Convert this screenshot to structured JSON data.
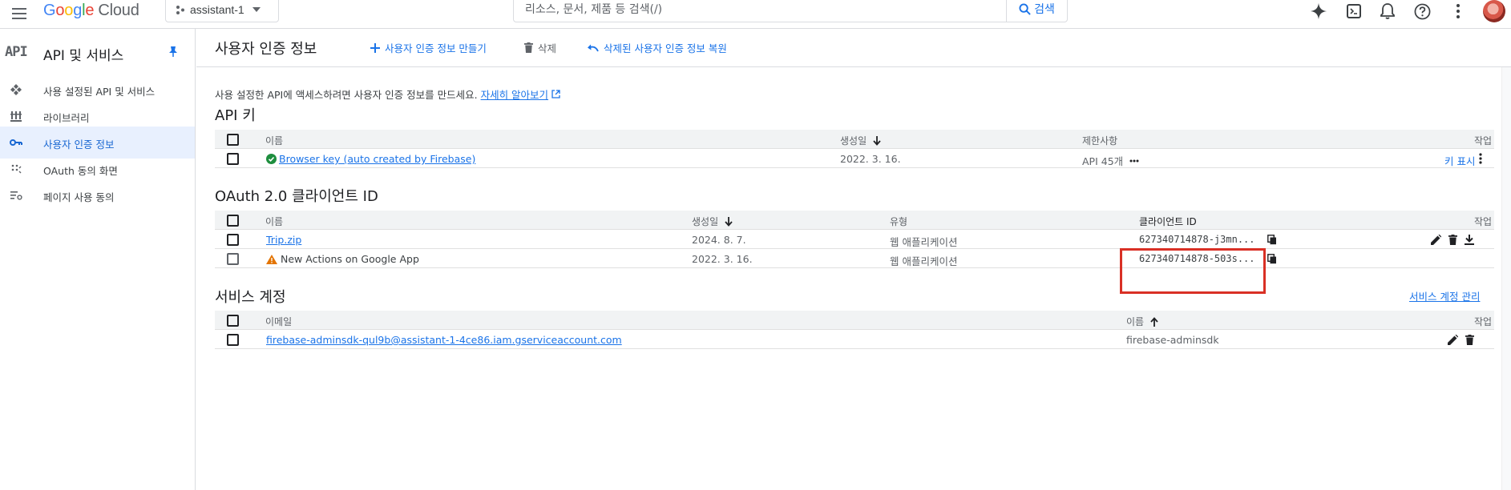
{
  "topbar": {
    "logo_google": "Google",
    "logo_cloud": "Cloud",
    "project": "assistant-1",
    "search_placeholder": "리소스, 문서, 제품 등 검색(/)",
    "search_button": "검색"
  },
  "leftnav": {
    "api_mark": "API",
    "title": "API 및 서비스",
    "items": [
      {
        "label": "사용 설정된 API 및 서비스",
        "icon": "api-hub-icon"
      },
      {
        "label": "라이브러리",
        "icon": "library-icon"
      },
      {
        "label": "사용자 인증 정보",
        "icon": "key-icon",
        "active": true
      },
      {
        "label": "OAuth 동의 화면",
        "icon": "oauth-icon"
      },
      {
        "label": "페이지 사용 동의",
        "icon": "page-consent-icon"
      }
    ]
  },
  "main": {
    "title": "사용자 인증 정보",
    "actions": {
      "create": "사용자 인증 정보 만들기",
      "delete": "삭제",
      "restore": "삭제된 사용자 인증 정보 복원"
    },
    "description": "사용 설정한 API에 액세스하려면 사용자 인증 정보를 만드세요.",
    "learn_more": "자세히 알아보기"
  },
  "api_keys": {
    "title": "API 키",
    "headers": {
      "name": "이름",
      "created": "생성일",
      "restrictions": "제한사항",
      "actions": "작업"
    },
    "rows": [
      {
        "name": "Browser key (auto created by Firebase)",
        "created": "2022. 3. 16.",
        "restrictions": "API 45개",
        "action_link": "키 표시"
      }
    ]
  },
  "oauth": {
    "title": "OAuth 2.0 클라이언트 ID",
    "headers": {
      "name": "이름",
      "created": "생성일",
      "type": "유형",
      "client_id": "클라이언트 ID",
      "actions": "작업"
    },
    "rows": [
      {
        "name": "Trip.zip",
        "created": "2024. 8. 7.",
        "type": "웹 애플리케이션",
        "client_id": "627340714878-j3mn..."
      },
      {
        "name": "New Actions on Google App",
        "created": "2022. 3. 16.",
        "type": "웹 애플리케이션",
        "client_id": "627340714878-503s..."
      }
    ]
  },
  "service_accounts": {
    "title": "서비스 계정",
    "manage_link": "서비스 계정 관리",
    "headers": {
      "email": "이메일",
      "name": "이름",
      "actions": "작업"
    },
    "rows": [
      {
        "email": "firebase-adminsdk-qul9b@assistant-1-4ce86.iam.gserviceaccount.com",
        "name": "firebase-adminsdk"
      }
    ]
  },
  "colors": {
    "accent": "#1a73e8",
    "highlight": "#d93025",
    "success": "#1e8e3e",
    "warning": "#e37400",
    "nav_active_bg": "#e8f0fe"
  }
}
